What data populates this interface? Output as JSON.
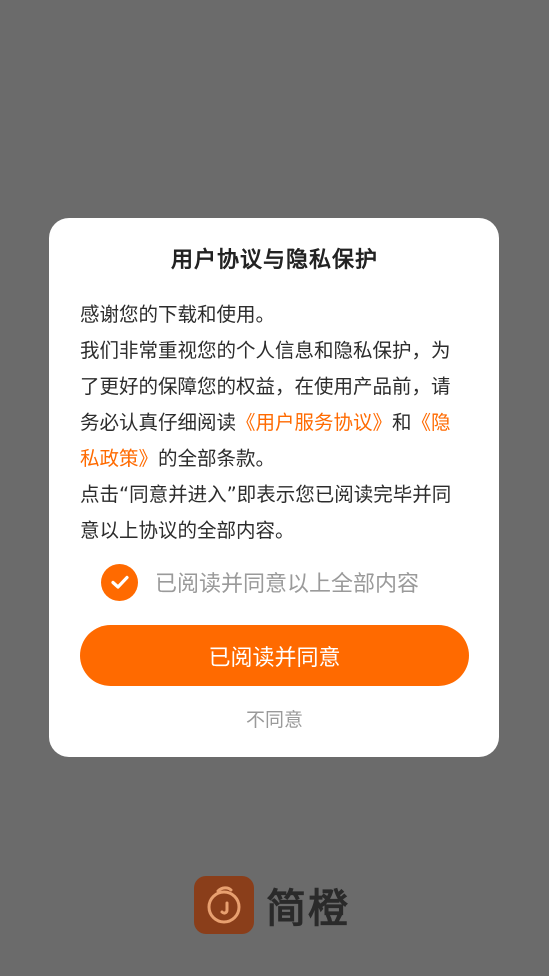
{
  "dialog": {
    "title": "用户协议与隐私保护",
    "line1": "感谢您的下载和使用。",
    "line2": "我们非常重视您的个人信息和隐私保护，为了更好的保障您的权益，在使用产品前，请务必认真仔细阅读",
    "user_agreement_link": "《用户服务协议》",
    "and_text": "和",
    "privacy_policy_link": "《隐私政策》",
    "all_terms_text": "的全部条款。",
    "line3": "点击“同意并进入”即表示您已阅读完毕并同意以上协议的全部内容。",
    "checkbox": {
      "label": "已阅读并同意以上全部内容",
      "checked": true
    },
    "agree_button": "已阅读并同意",
    "disagree_link": "不同意"
  },
  "brand": {
    "name": "简橙",
    "accent_color": "#ff6a00",
    "logo_bg": "#8a3e1a",
    "icon": "orange-logo-icon"
  },
  "colors": {
    "overlay": "#6b6b6b",
    "dialog_bg": "#ffffff"
  }
}
